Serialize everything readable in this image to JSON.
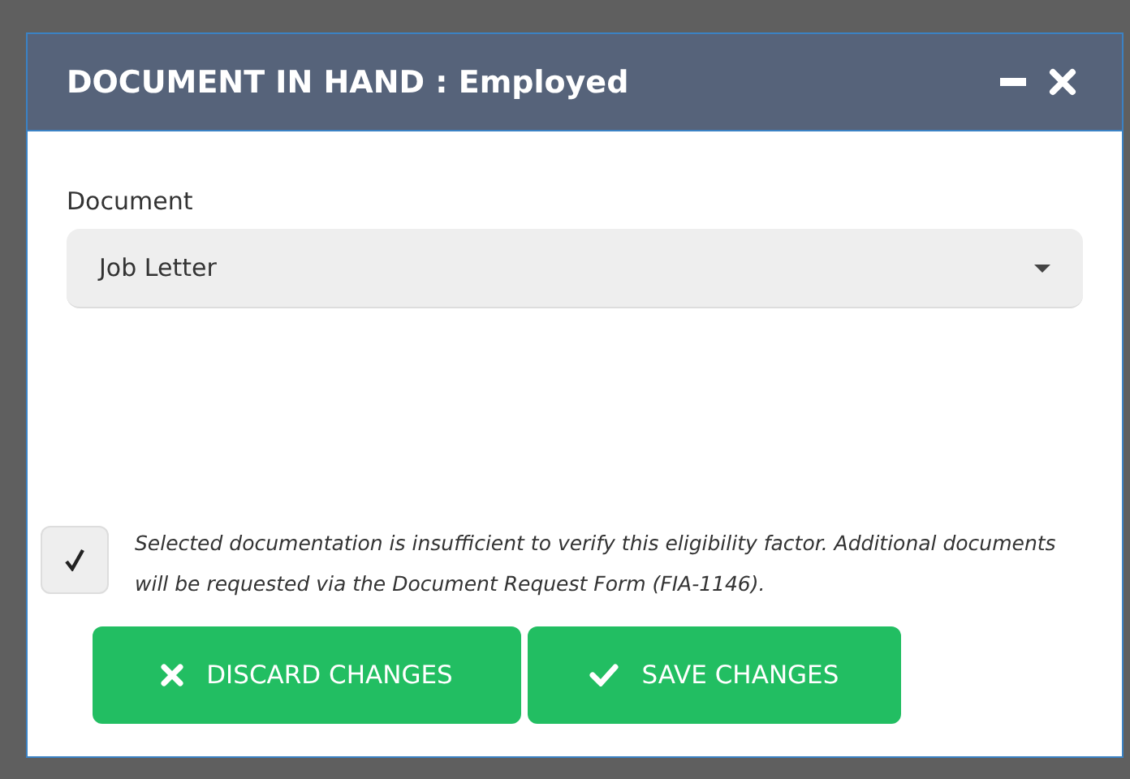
{
  "dialog": {
    "title": "DOCUMENT IN HAND : Employed"
  },
  "document": {
    "label": "Document",
    "value": "Job Letter"
  },
  "acknowledgement": {
    "checked": true,
    "text": "Selected documentation is insufficient to verify this eligibility factor. Additional documents will be requested via the Document Request Form (FIA-1146)."
  },
  "buttons": [
    {
      "kind": "discard",
      "label": "DISCARD CHANGES"
    },
    {
      "kind": "save",
      "label": "SAVE CHANGES"
    }
  ]
}
